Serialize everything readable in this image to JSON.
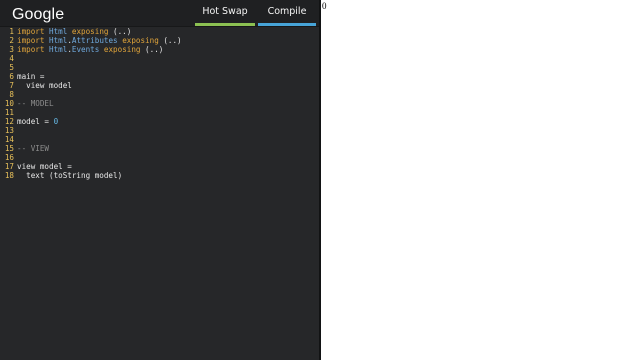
{
  "header": {
    "logo": "Google",
    "tabs": [
      {
        "label": "Hot Swap",
        "accent": "#8cc152"
      },
      {
        "label": "Compile",
        "accent": "#47a4d8"
      }
    ]
  },
  "editor": {
    "lines": [
      {
        "n": "1",
        "tokens": [
          {
            "t": "import",
            "c": "kw"
          },
          {
            "t": " ",
            "c": "txt"
          },
          {
            "t": "Html",
            "c": "mod"
          },
          {
            "t": " ",
            "c": "txt"
          },
          {
            "t": "exposing",
            "c": "kw"
          },
          {
            "t": " (..)",
            "c": "txt"
          }
        ]
      },
      {
        "n": "2",
        "tokens": [
          {
            "t": "import",
            "c": "kw"
          },
          {
            "t": " ",
            "c": "txt"
          },
          {
            "t": "Html",
            "c": "mod"
          },
          {
            "t": ".",
            "c": "txt"
          },
          {
            "t": "Attributes",
            "c": "mod"
          },
          {
            "t": " ",
            "c": "txt"
          },
          {
            "t": "exposing",
            "c": "kw"
          },
          {
            "t": " (..)",
            "c": "txt"
          }
        ]
      },
      {
        "n": "3",
        "tokens": [
          {
            "t": "import",
            "c": "kw"
          },
          {
            "t": " ",
            "c": "txt"
          },
          {
            "t": "Html",
            "c": "mod"
          },
          {
            "t": ".",
            "c": "txt"
          },
          {
            "t": "Events",
            "c": "mod"
          },
          {
            "t": " ",
            "c": "txt"
          },
          {
            "t": "exposing",
            "c": "kw"
          },
          {
            "t": " (..)",
            "c": "txt"
          }
        ]
      },
      {
        "n": "4",
        "tokens": []
      },
      {
        "n": "5",
        "tokens": []
      },
      {
        "n": "6",
        "tokens": [
          {
            "t": "main =",
            "c": "txt"
          }
        ]
      },
      {
        "n": "7",
        "tokens": [
          {
            "t": "  view model",
            "c": "txt"
          }
        ]
      },
      {
        "n": "8",
        "tokens": []
      },
      {
        "n": "10",
        "tokens": [
          {
            "t": "-- MODEL",
            "c": "cmt"
          }
        ]
      },
      {
        "n": "11",
        "tokens": []
      },
      {
        "n": "12",
        "tokens": [
          {
            "t": "model = ",
            "c": "txt"
          },
          {
            "t": "0",
            "c": "num"
          }
        ]
      },
      {
        "n": "13",
        "tokens": []
      },
      {
        "n": "14",
        "tokens": []
      },
      {
        "n": "15",
        "tokens": [
          {
            "t": "-- VIEW",
            "c": "cmt"
          }
        ]
      },
      {
        "n": "16",
        "tokens": []
      },
      {
        "n": "17",
        "tokens": [
          {
            "t": "view model =",
            "c": "txt"
          }
        ]
      },
      {
        "n": "18",
        "tokens": [
          {
            "t": "  text (toString model)",
            "c": "txt"
          }
        ]
      }
    ]
  },
  "output": {
    "text": "0"
  }
}
